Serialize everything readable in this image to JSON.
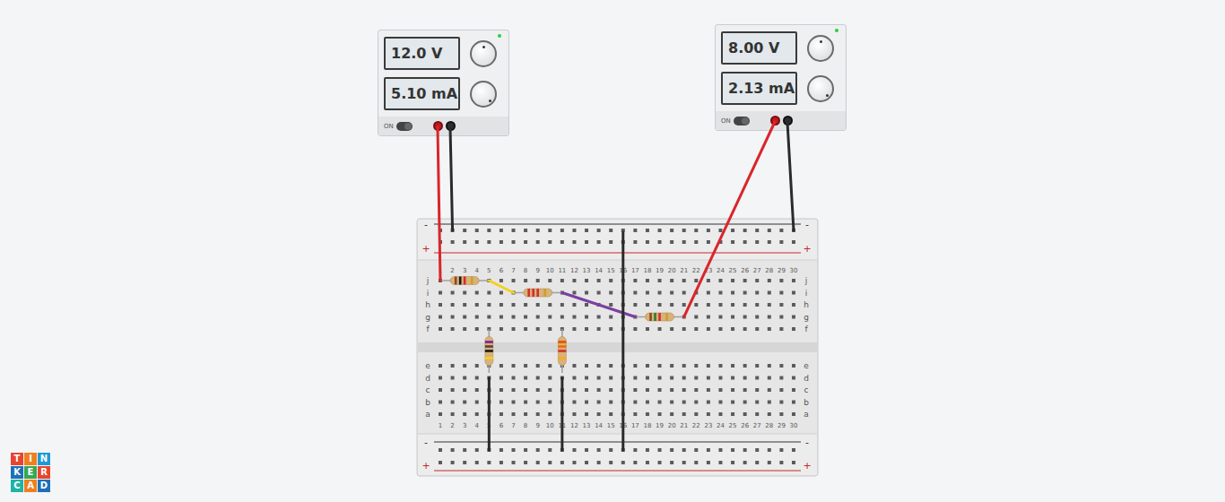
{
  "power_supplies": [
    {
      "voltage": "12.0 V",
      "current": "5.10 mA",
      "switch_label": "ON",
      "on": true
    },
    {
      "voltage": "8.00 V",
      "current": "2.13 mA",
      "switch_label": "ON",
      "on": true
    }
  ],
  "breadboard": {
    "columns": [
      "1",
      "2",
      "3",
      "4",
      "5",
      "6",
      "7",
      "8",
      "9",
      "10",
      "11",
      "12",
      "13",
      "14",
      "15",
      "16",
      "17",
      "18",
      "19",
      "20",
      "21",
      "22",
      "23",
      "24",
      "25",
      "26",
      "27",
      "28",
      "29",
      "30"
    ],
    "rows_top": [
      "j",
      "i",
      "h",
      "g",
      "f"
    ],
    "rows_bottom": [
      "e",
      "d",
      "c",
      "b",
      "a"
    ],
    "rail_minus": "-",
    "rail_plus": "+"
  },
  "resistors": [
    {
      "bands": [
        "#8d4b1f",
        "#1a1a1a",
        "#d32f2f",
        "#c9a227"
      ]
    },
    {
      "bands": [
        "#d32f2f",
        "#d32f2f",
        "#d32f2f",
        "#c9a227"
      ]
    },
    {
      "bands": [
        "#8d4b1f",
        "#2e7d32",
        "#d32f2f",
        "#c9a227"
      ]
    },
    {
      "bands": [
        "#7b1fa2",
        "#5d4037",
        "#1a1a1a",
        "#f2d21b"
      ]
    },
    {
      "bands": [
        "#e65100",
        "#ef6c00",
        "#d32f2f",
        "#f9a825"
      ]
    }
  ],
  "wires": [
    {
      "color": "#d9262b"
    },
    {
      "color": "#2b2b2b"
    },
    {
      "color": "#d9262b"
    },
    {
      "color": "#2b2b2b"
    },
    {
      "color": "#f2d21b"
    },
    {
      "color": "#7b3fa0"
    },
    {
      "color": "#2b2b2b"
    },
    {
      "color": "#2b2b2b"
    },
    {
      "color": "#2b2b2b"
    }
  ],
  "logo": {
    "letters": [
      "T",
      "I",
      "N",
      "K",
      "E",
      "R",
      "C",
      "A",
      "D"
    ]
  }
}
